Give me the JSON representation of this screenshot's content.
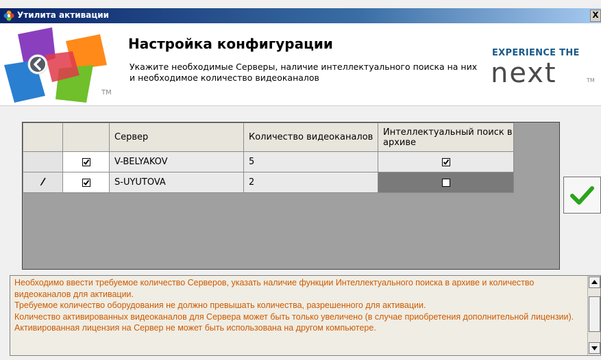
{
  "window": {
    "title": "Утилита активации",
    "close_glyph": "X"
  },
  "header": {
    "title": "Настройка конфигурации",
    "subtitle": "Укажите необходимые Серверы, наличие интеллектуального поиска на них и необходимое количество видеоканалов",
    "logo_tm": "TM",
    "brand_tagline": "EXPERIENCE THE",
    "brand_word": "next",
    "brand_tm": "TM"
  },
  "grid": {
    "columns": [
      "",
      "",
      "Сервер",
      "Количество видеоканалов",
      "Интеллектуальный поиск в архиве"
    ],
    "rows": [
      {
        "row_marker": "",
        "selected": true,
        "server": "V-BELYAKOV",
        "channels": "5",
        "intelligent_search": true
      },
      {
        "row_marker": "edit",
        "selected": true,
        "server": "S-UYUTOVA",
        "channels": "2",
        "intelligent_search": false
      }
    ]
  },
  "info": {
    "text": "Необходимо ввести требуемое количество Серверов, указать наличие функции Интеллектуального поиска в архиве и количество видеоканалов для активации.\nТребуемое количество оборудования не должно превышать количества, разрешенного для активации.\nКоличество активированных видеоканалов для Сервера может быть только увеличено (в случае приобретения дополнительной лицензии). Активированная лицензия на Сервер не может быть использована на другом компьютере."
  },
  "icons": {
    "app": "app-flower-icon",
    "back": "back-arrow-icon",
    "ok": "checkmark-icon",
    "edit": "pencil-icon",
    "scroll_up": "scroll-up-arrow-icon",
    "scroll_down": "scroll-down-arrow-icon"
  },
  "colors": {
    "titlebar": "#0a246a",
    "info_text": "#cc5a00",
    "ok_check": "#2aa31a",
    "brand": "#1a5b8a"
  }
}
